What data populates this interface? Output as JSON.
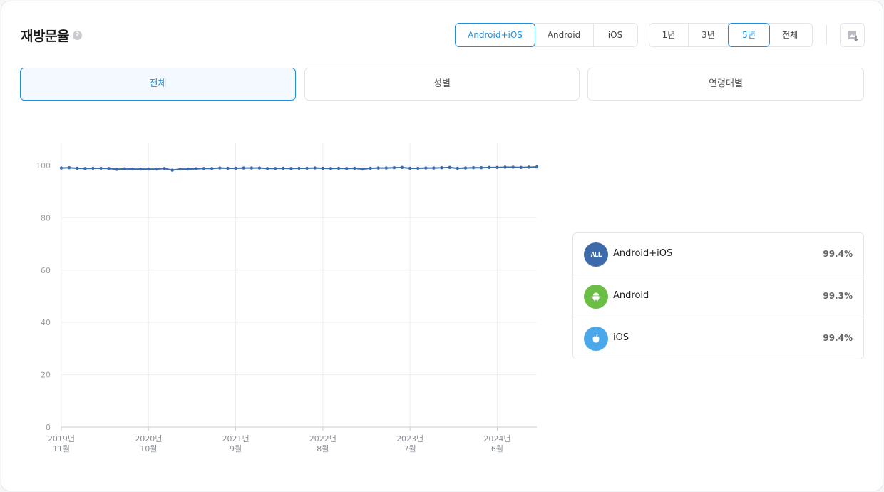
{
  "header": {
    "title": "재방문율",
    "help_icon": "?"
  },
  "platform_filter": {
    "options": [
      "Android+iOS",
      "Android",
      "iOS"
    ],
    "selected": "Android+iOS"
  },
  "period_filter": {
    "options": [
      "1년",
      "3년",
      "5년",
      "전체"
    ],
    "selected": "5년"
  },
  "download_icon": "download-image-icon",
  "tabs": {
    "items": [
      "전체",
      "성별",
      "연령대별"
    ],
    "selected": "전체"
  },
  "legend": {
    "items": [
      {
        "icon": "all-icon",
        "badge_text": "ALL",
        "name": "Android+iOS",
        "value": "99.4%",
        "color": "#3d6aa8"
      },
      {
        "icon": "android-icon",
        "name": "Android",
        "value": "99.3%",
        "color": "#6cbd45"
      },
      {
        "icon": "apple-icon",
        "name": "iOS",
        "value": "99.4%",
        "color": "#4aa8ea"
      }
    ]
  },
  "colors": {
    "accent": "#1e8fdc",
    "series": "#3d6aa8"
  },
  "chart_data": {
    "type": "line",
    "title": "",
    "xlabel": "",
    "ylabel": "",
    "ylim": [
      0,
      100
    ],
    "yticks": [
      0,
      20,
      40,
      60,
      80,
      100
    ],
    "xticks": [
      {
        "line1": "2019년",
        "line2": "11월",
        "index": 0
      },
      {
        "line1": "2020년",
        "line2": "10월",
        "index": 11
      },
      {
        "line1": "2021년",
        "line2": "9월",
        "index": 22
      },
      {
        "line1": "2022년",
        "line2": "8월",
        "index": 33
      },
      {
        "line1": "2023년",
        "line2": "7월",
        "index": 44
      },
      {
        "line1": "2024년",
        "line2": "6월",
        "index": 55
      }
    ],
    "grid": true,
    "series": [
      {
        "name": "Android+iOS",
        "values": [
          99.0,
          99.1,
          98.9,
          98.8,
          98.9,
          98.9,
          98.8,
          98.5,
          98.7,
          98.6,
          98.6,
          98.6,
          98.6,
          98.8,
          98.2,
          98.6,
          98.6,
          98.7,
          98.8,
          98.8,
          99.0,
          98.9,
          98.9,
          99.0,
          99.0,
          99.0,
          98.8,
          98.8,
          98.9,
          98.8,
          98.9,
          98.9,
          99.0,
          98.9,
          98.8,
          98.9,
          98.8,
          98.9,
          98.6,
          98.9,
          99.0,
          99.0,
          99.1,
          99.2,
          98.9,
          98.9,
          99.0,
          99.0,
          99.1,
          99.2,
          98.9,
          99.0,
          99.1,
          99.1,
          99.2,
          99.2,
          99.3,
          99.3,
          99.2,
          99.3,
          99.4
        ]
      }
    ]
  }
}
